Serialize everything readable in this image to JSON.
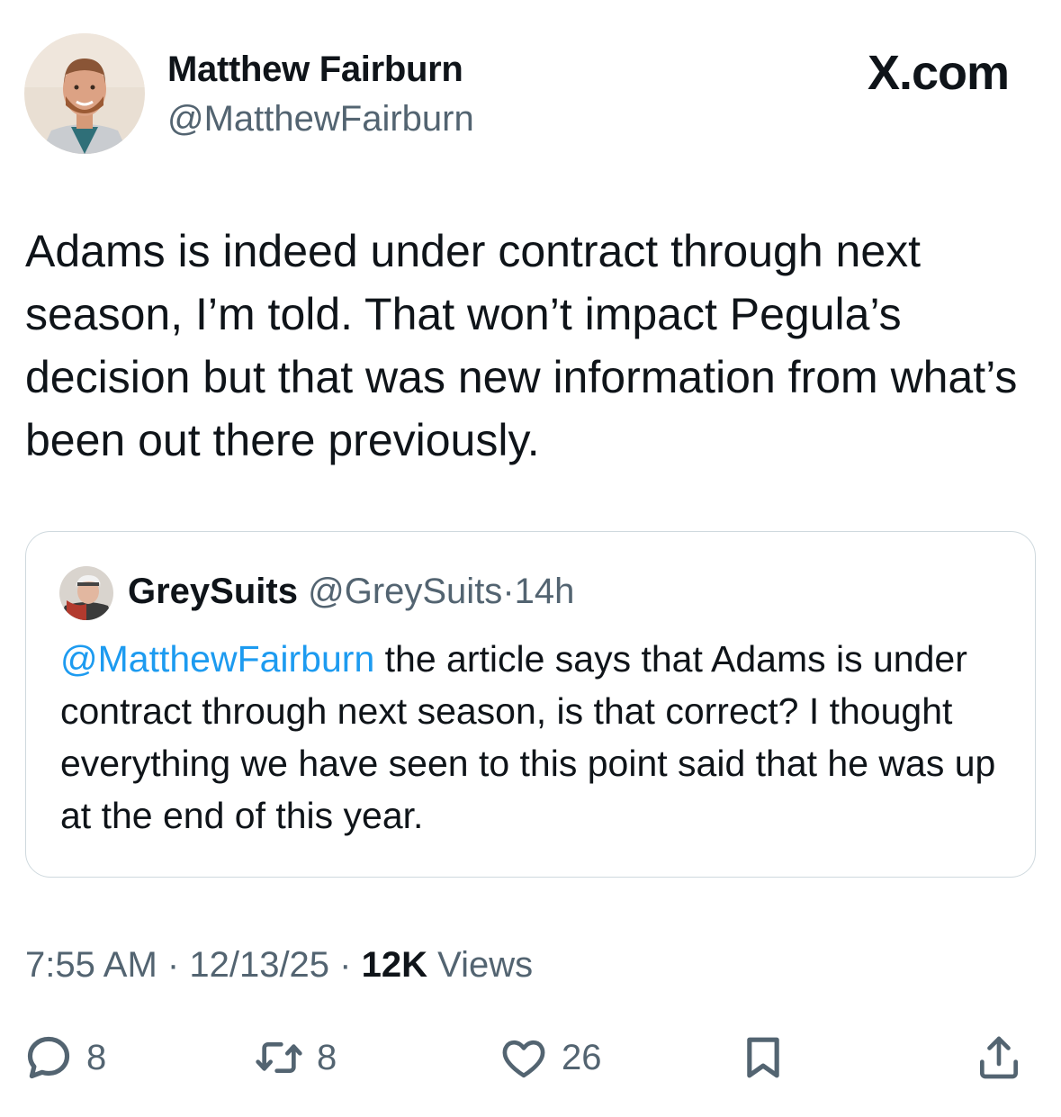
{
  "author": {
    "display_name": "Matthew Fairburn",
    "handle": "@MatthewFairburn"
  },
  "brand": "X.com",
  "tweet": {
    "text": "Adams is indeed under contract through next season, I’m told. That won’t impact Pegula’s decision but that was new information from what’s been out there previously."
  },
  "quoted": {
    "display_name": "GreySuits",
    "handle": "@GreySuits",
    "separator": "·",
    "time": "14h",
    "mention": "@MatthewFairburn",
    "text": " the article says that Adams is under contract through next season, is that correct? I thought everything we have seen to this point said that he was up at the end of this year."
  },
  "meta": {
    "time": "7:55 AM",
    "separator": "·",
    "date": "12/13/25",
    "views_count": "12K",
    "views_label": "Views"
  },
  "actions": {
    "replies": "8",
    "reposts": "8",
    "likes": "26"
  },
  "colors": {
    "text": "#0f1419",
    "secondary": "#536471",
    "link": "#1d9bf0",
    "border": "#cfd9de"
  },
  "icons": [
    "reply-icon",
    "repost-icon",
    "like-icon",
    "bookmark-icon",
    "share-icon"
  ]
}
